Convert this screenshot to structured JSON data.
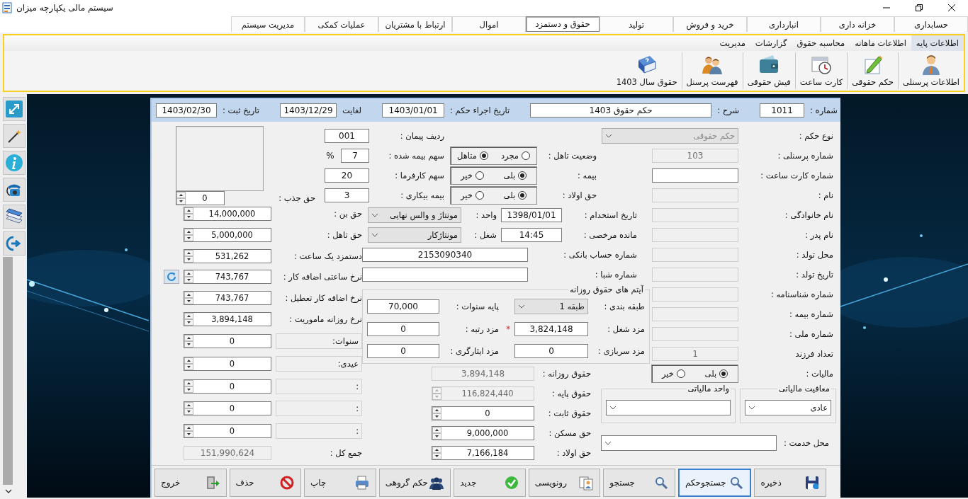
{
  "window": {
    "title": "سیستم مالی یکپارچه میزان"
  },
  "menu": [
    {
      "label": "حسابداری",
      "selected": false
    },
    {
      "label": "خزانه داری",
      "selected": false
    },
    {
      "label": "انبارداری",
      "selected": false
    },
    {
      "label": "خرید و فروش",
      "selected": false
    },
    {
      "label": "تولید",
      "selected": false
    },
    {
      "label": "حقوق و دستمزد",
      "selected": true
    },
    {
      "label": "اموال",
      "selected": false
    },
    {
      "label": "ارتباط با مشتریان",
      "selected": false
    },
    {
      "label": "عملیات کمکی",
      "selected": false
    },
    {
      "label": "مدیریت سیستم",
      "selected": false
    }
  ],
  "ribbon": {
    "tabs": [
      {
        "label": "اطلاعات پایه",
        "selected": true
      },
      {
        "label": "اطلاعات ماهانه",
        "selected": false
      },
      {
        "label": "محاسبه حقوق",
        "selected": false
      },
      {
        "label": "گزارشات",
        "selected": false
      },
      {
        "label": "مدیریت",
        "selected": false
      }
    ],
    "buttons": [
      {
        "label": "اطلاعات پرسنلی"
      },
      {
        "label": "حکم حقوقی"
      },
      {
        "label": "کارت ساعت"
      },
      {
        "label": "فیش حقوقی"
      },
      {
        "label": "فهرست پرسنل"
      },
      {
        "label": "حقوق سال 1403"
      }
    ]
  },
  "form": {
    "header": [
      {
        "label": "شماره :",
        "value": "1011"
      },
      {
        "label": "شرح :",
        "value": "حکم حقوق 1403"
      },
      {
        "label": "تاریخ اجراء حکم :",
        "value": "1403/01/01"
      },
      {
        "label": "لغایت",
        "value": "1403/12/29"
      },
      {
        "label": "تاریخ ثبت :",
        "value": "1403/02/30"
      }
    ],
    "personnel": [
      {
        "label": "نوع حکم :",
        "kind": "select",
        "value": "حکم حقوقی",
        "disabled": true
      },
      {
        "label": "شماره پرسنلی :",
        "kind": "text",
        "value": "103",
        "disabled": true
      },
      {
        "label": "شماره کارت ساعت :",
        "kind": "text",
        "disabled": false
      },
      {
        "label": "نام :",
        "kind": "text",
        "disabled": true
      },
      {
        "label": "نام خانوادگی :",
        "kind": "text",
        "disabled": true
      },
      {
        "label": "نام پدر :",
        "kind": "text",
        "disabled": true
      },
      {
        "label": "محل تولد :",
        "kind": "text",
        "disabled": true
      },
      {
        "label": "تاریخ تولد :",
        "kind": "text",
        "disabled": true
      },
      {
        "label": "شماره شناسنامه :",
        "kind": "text",
        "disabled": true
      },
      {
        "label": "شماره بیمه :",
        "kind": "text",
        "disabled": true
      },
      {
        "label": "شماره ملی :",
        "kind": "text",
        "disabled": true
      },
      {
        "label": "تعداد فرزند",
        "kind": "text",
        "value": "1",
        "disabled": true
      },
      {
        "label": "مالیات :",
        "kind": "radio",
        "options": [
          {
            "label": "بلی",
            "selected": true
          },
          {
            "label": "خیر",
            "selected": false
          }
        ]
      }
    ],
    "tax": [
      {
        "label": "معافیت مالیاتی",
        "value": "عادی"
      },
      {
        "label": "واحد مالیاتی"
      }
    ],
    "service_place": {
      "label": "محل خدمت :"
    },
    "status": [
      {
        "label": "وضعیت تاهل :",
        "kind": "radio",
        "options": [
          {
            "label": "مجرد",
            "selected": false
          },
          {
            "label": "متاهل",
            "selected": true
          }
        ]
      },
      {
        "label": "بیمه :",
        "kind": "radio",
        "options": [
          {
            "label": "بلی",
            "selected": true
          },
          {
            "label": "خیر",
            "selected": false
          }
        ]
      },
      {
        "label": "حق اولاد :",
        "kind": "radio",
        "options": [
          {
            "label": "بلی",
            "selected": true
          },
          {
            "label": "خیر",
            "selected": false
          }
        ]
      }
    ],
    "insurance": [
      {
        "label": "ردیف پیمان :",
        "value": "001"
      },
      {
        "label": "سهم بیمه شده :",
        "value": "7",
        "unit": "%"
      },
      {
        "label": "سهم کارفرما :",
        "value": "20"
      },
      {
        "label": "بیمه بیکاری :",
        "value": "3"
      }
    ],
    "employment": [
      {
        "label": "تاریخ استخدام :",
        "kind": "text",
        "value": "1398/01/01",
        "disabled": false
      },
      {
        "label": "واحد :",
        "kind": "select",
        "value": "مونتاژ و والس نهایی",
        "disabled": true
      },
      {
        "label": "مانده مرخصی :",
        "kind": "text",
        "value": "14:45",
        "disabled": false
      },
      {
        "label": "شغل :",
        "kind": "select",
        "value": "مونتاژکار",
        "disabled": true
      },
      {
        "label": "شماره حساب بانکی :",
        "kind": "text",
        "value": "2153090340",
        "disabled": false
      },
      {
        "label": "شماره شبا :",
        "kind": "text",
        "disabled": false
      }
    ],
    "daily_items": {
      "title": "آیتم های حقوق روزانه",
      "fields": [
        {
          "label": "طبقه بندی :",
          "kind": "select",
          "value": "طبقه 1",
          "disabled": true
        },
        {
          "label": "پایه سنوات :",
          "kind": "text",
          "value": "70,000",
          "disabled": false
        },
        {
          "label": "مزد شغل :",
          "kind": "text",
          "value": "3,824,148",
          "disabled": false,
          "marker": "*"
        },
        {
          "label": "مزد رتبه :",
          "kind": "text",
          "value": "0",
          "disabled": false
        },
        {
          "label": "مزد سربازی :",
          "kind": "text",
          "value": "0",
          "disabled": false
        },
        {
          "label": "مزد ایثارگری :",
          "kind": "text",
          "value": "0",
          "disabled": false
        }
      ]
    },
    "salary": [
      {
        "label": "حقوق روزانه :",
        "kind": "text",
        "value": "3,894,148",
        "disabled": true
      },
      {
        "label": "حقوق پایه :",
        "kind": "spin",
        "value": "116,824,440",
        "disabled": true
      },
      {
        "label": "حقوق ثابت :",
        "kind": "spin",
        "value": "0",
        "disabled": false
      },
      {
        "label": "حق مسکن :",
        "kind": "spin",
        "value": "9,000,000",
        "disabled": false
      },
      {
        "label": "حق اولاد :",
        "kind": "spin",
        "value": "7,166,184",
        "disabled": false
      }
    ],
    "allowances": [
      {
        "label": "حق جذب :",
        "kind": "spin",
        "value": "0"
      },
      {
        "label": "حق بن :",
        "kind": "spin",
        "value": "14,000,000"
      },
      {
        "label": "حق تاهل :",
        "kind": "spin",
        "value": "5,000,000"
      },
      {
        "label": "دستمزد یک ساعت :",
        "kind": "spin",
        "value": "531,262"
      },
      {
        "label": "نرخ ساعتی اضافه کار :",
        "kind": "spin",
        "value": "743,767"
      },
      {
        "label": "نرخ اضافه کار تعطیل :",
        "kind": "spin",
        "value": "743,767"
      },
      {
        "label": "نرخ روزانه ماموریت :",
        "kind": "spin",
        "value": "3,894,148"
      },
      {
        "label": "سنوات:",
        "kind": "extra",
        "value": "0"
      },
      {
        "label": "عیدی:",
        "kind": "extra",
        "value": "0"
      },
      {
        "label": ":",
        "kind": "extra",
        "value": "0"
      },
      {
        "label": ":",
        "kind": "extra",
        "value": "0"
      },
      {
        "label": ":",
        "kind": "extra",
        "value": "0"
      },
      {
        "label": "جمع کل :",
        "kind": "total",
        "value": "151,990,624"
      }
    ],
    "actions": [
      {
        "label": "ذخیره",
        "selected": false
      },
      {
        "label": "جستجوحکم",
        "selected": true
      },
      {
        "label": "جستجو",
        "selected": false
      },
      {
        "label": "رونویسی",
        "selected": false
      },
      {
        "label": "جدید",
        "selected": false
      },
      {
        "label": "حکم گروهی",
        "selected": false
      },
      {
        "label": "چاپ",
        "selected": false
      },
      {
        "label": "حذف",
        "selected": false
      },
      {
        "label": "خروج",
        "selected": false
      }
    ]
  }
}
